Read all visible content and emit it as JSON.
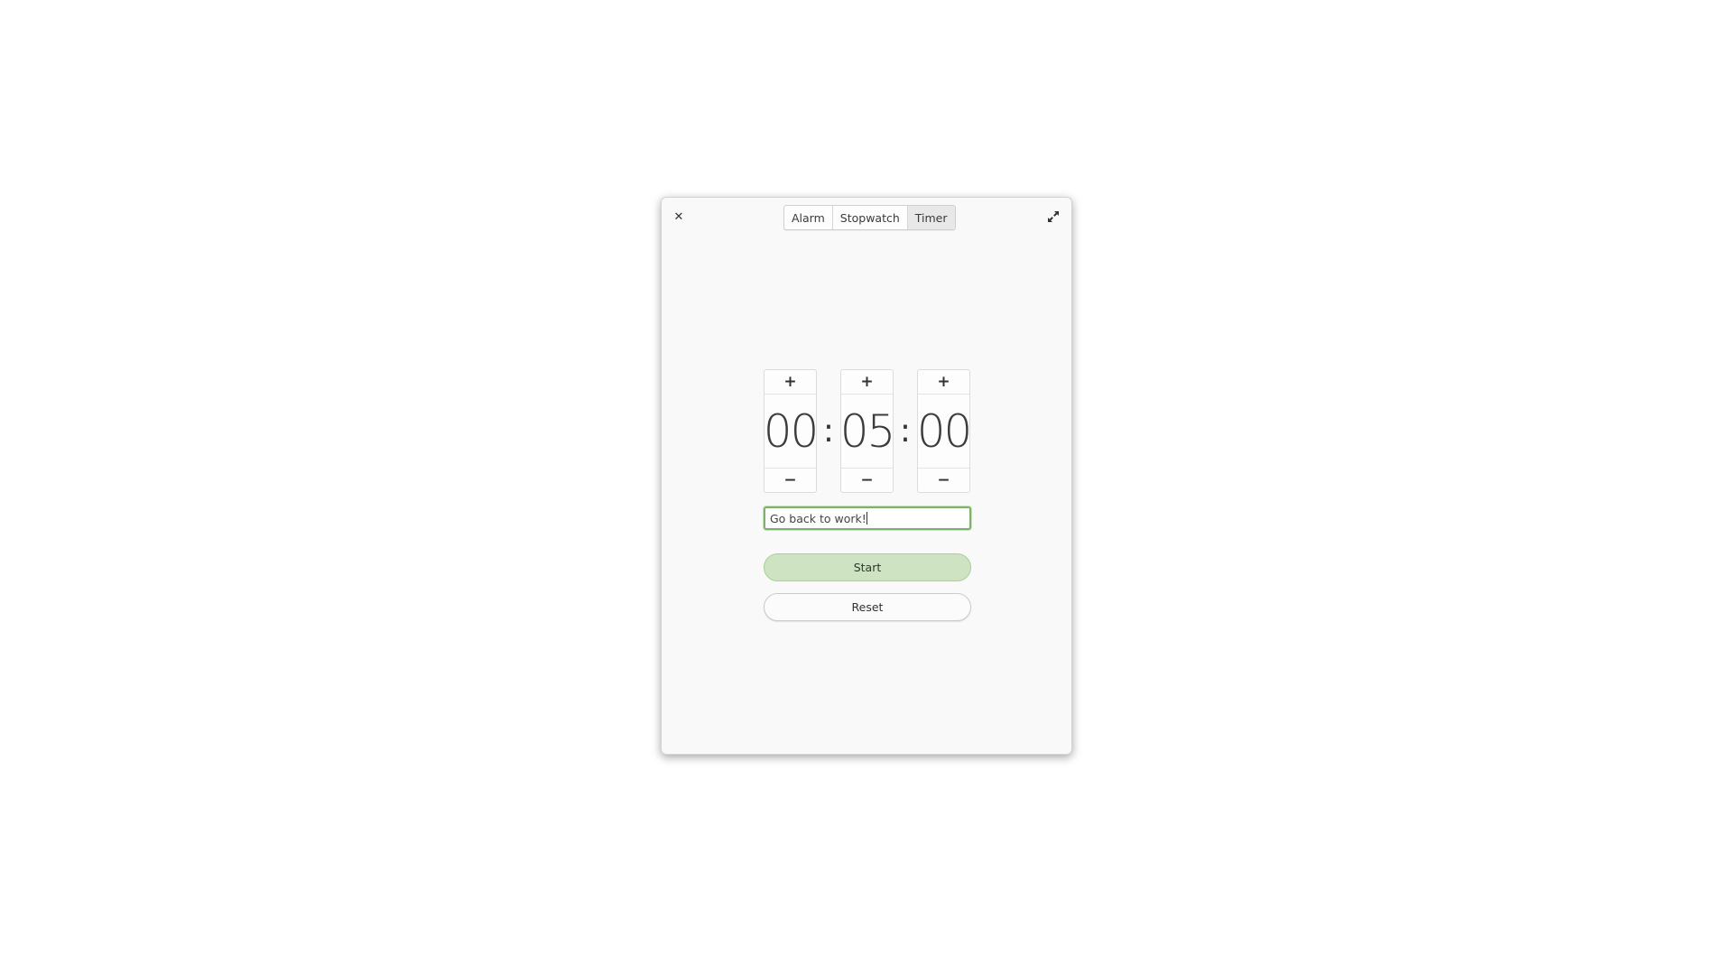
{
  "window": {
    "close_icon": "close-icon",
    "expand_icon": "expand-icon"
  },
  "tabs": [
    {
      "label": "Alarm",
      "active": false
    },
    {
      "label": "Stopwatch",
      "active": false
    },
    {
      "label": "Timer",
      "active": true
    }
  ],
  "timer": {
    "hours": "00",
    "minutes": "05",
    "seconds": "00",
    "separator": ":",
    "plus_label": "+",
    "minus_label": "−"
  },
  "message_entry": {
    "value": "Go back to work!"
  },
  "buttons": {
    "start_label": "Start",
    "reset_label": "Reset"
  },
  "colors": {
    "accent": "#cde3c2",
    "entry_focus": "#7fb06e"
  }
}
